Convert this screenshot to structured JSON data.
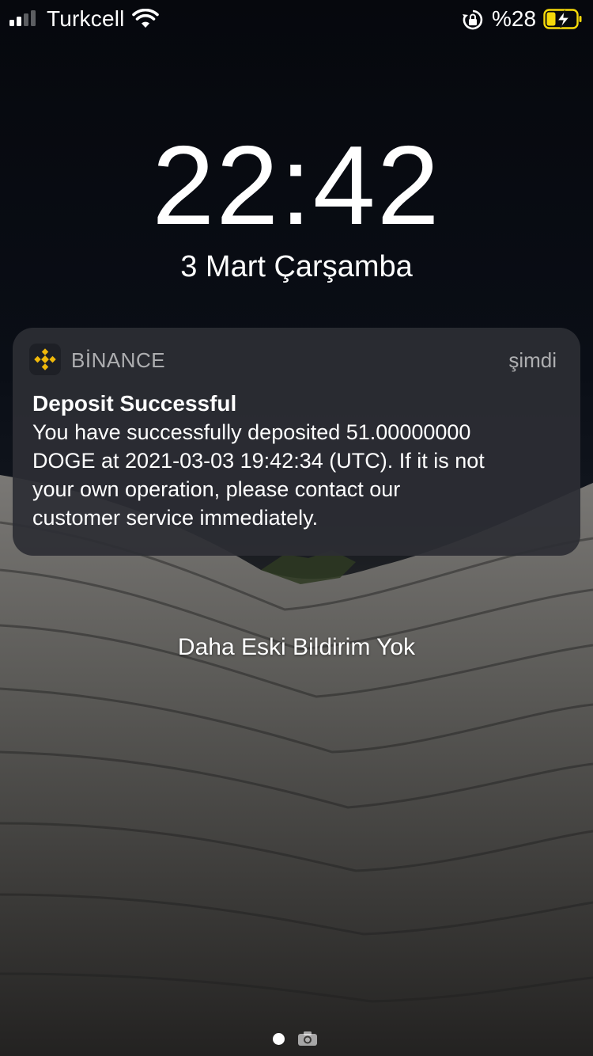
{
  "status_bar": {
    "carrier": "Turkcell",
    "battery_percent": "%28",
    "signal_bars_active": 2,
    "signal_bars_total": 4,
    "icons": [
      "signal-icon",
      "wifi-icon",
      "rotation-lock-icon",
      "battery-charging-icon"
    ]
  },
  "lock_screen": {
    "time": "22:42",
    "date": "3 Mart Çarşamba"
  },
  "notification": {
    "app_name": "BİNANCE",
    "app_icon": "binance-logo-icon",
    "time": "şimdi",
    "title": "Deposit Successful",
    "body": "You have successfully deposited 51.00000000\nDOGE at 2021-03-03 19:42:34 (UTC). If it is not\nyour own operation, please contact our\ncustomer service immediately."
  },
  "notification_center": {
    "empty_label": "Daha Eski Bildirim Yok"
  },
  "pager": {
    "icons": [
      "page-dot-icon",
      "camera-icon"
    ]
  },
  "colors": {
    "notification_bg": "#2c2e34",
    "binance_yellow": "#f0b90b",
    "battery_charging": "#f5d90a"
  }
}
